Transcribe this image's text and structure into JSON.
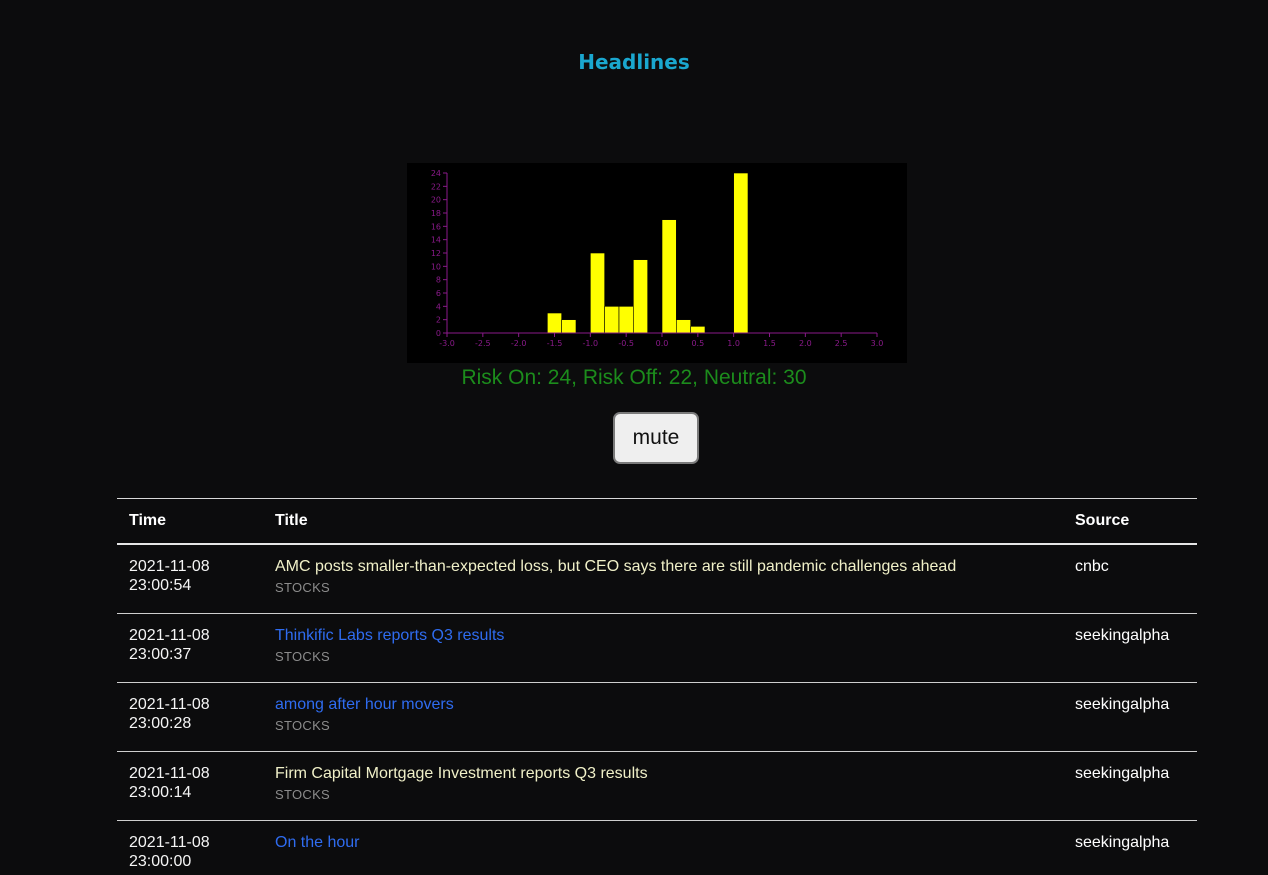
{
  "header": {
    "title": "Headlines"
  },
  "chart_data": {
    "type": "bar",
    "x_ticks": [
      "-3.0",
      "-2.5",
      "-2.0",
      "-1.5",
      "-1.0",
      "-0.5",
      "0.0",
      "0.5",
      "1.0",
      "1.5",
      "2.0",
      "2.5",
      "3.0"
    ],
    "y_ticks": [
      "0",
      "2",
      "4",
      "6",
      "8",
      "10",
      "12",
      "14",
      "16",
      "18",
      "20",
      "22",
      "24"
    ],
    "xlim": [
      -3.0,
      3.0
    ],
    "ylim": [
      0,
      24
    ],
    "bin_width": 0.2,
    "bins": [
      {
        "x0": -1.6,
        "count": 3
      },
      {
        "x0": -1.4,
        "count": 2
      },
      {
        "x0": -1.0,
        "count": 12
      },
      {
        "x0": -0.8,
        "count": 4
      },
      {
        "x0": -0.6,
        "count": 4
      },
      {
        "x0": -0.4,
        "count": 11
      },
      {
        "x0": 0.0,
        "count": 17
      },
      {
        "x0": 0.2,
        "count": 2
      },
      {
        "x0": 0.4,
        "count": 1
      },
      {
        "x0": 1.0,
        "count": 24
      }
    ],
    "bar_color": "#ffff00",
    "axis_color": "#8a1a8a"
  },
  "summary": "Risk On: 24, Risk Off: 22, Neutral: 30",
  "mute_label": "mute",
  "table": {
    "headers": {
      "time": "Time",
      "title": "Title",
      "source": "Source"
    },
    "rows": [
      {
        "date": "2021-11-08",
        "time": "23:00:54",
        "title": "AMC posts smaller-than-expected loss, but CEO says there are still pandemic challenges ahead",
        "category": "STOCKS",
        "source": "cnbc",
        "link": false
      },
      {
        "date": "2021-11-08",
        "time": "23:00:37",
        "title": "Thinkific Labs  reports Q3 results",
        "category": "STOCKS",
        "source": "seekingalpha",
        "link": true
      },
      {
        "date": "2021-11-08",
        "time": "23:00:28",
        "title": "among after hour movers",
        "category": "STOCKS",
        "source": "seekingalpha",
        "link": true
      },
      {
        "date": "2021-11-08",
        "time": "23:00:14",
        "title": "Firm Capital Mortgage Investment reports Q3 results",
        "category": "STOCKS",
        "source": "seekingalpha",
        "link": false
      },
      {
        "date": "2021-11-08",
        "time": "23:00:00",
        "title": "On the hour",
        "category": "",
        "source": "seekingalpha",
        "link": true
      }
    ]
  }
}
